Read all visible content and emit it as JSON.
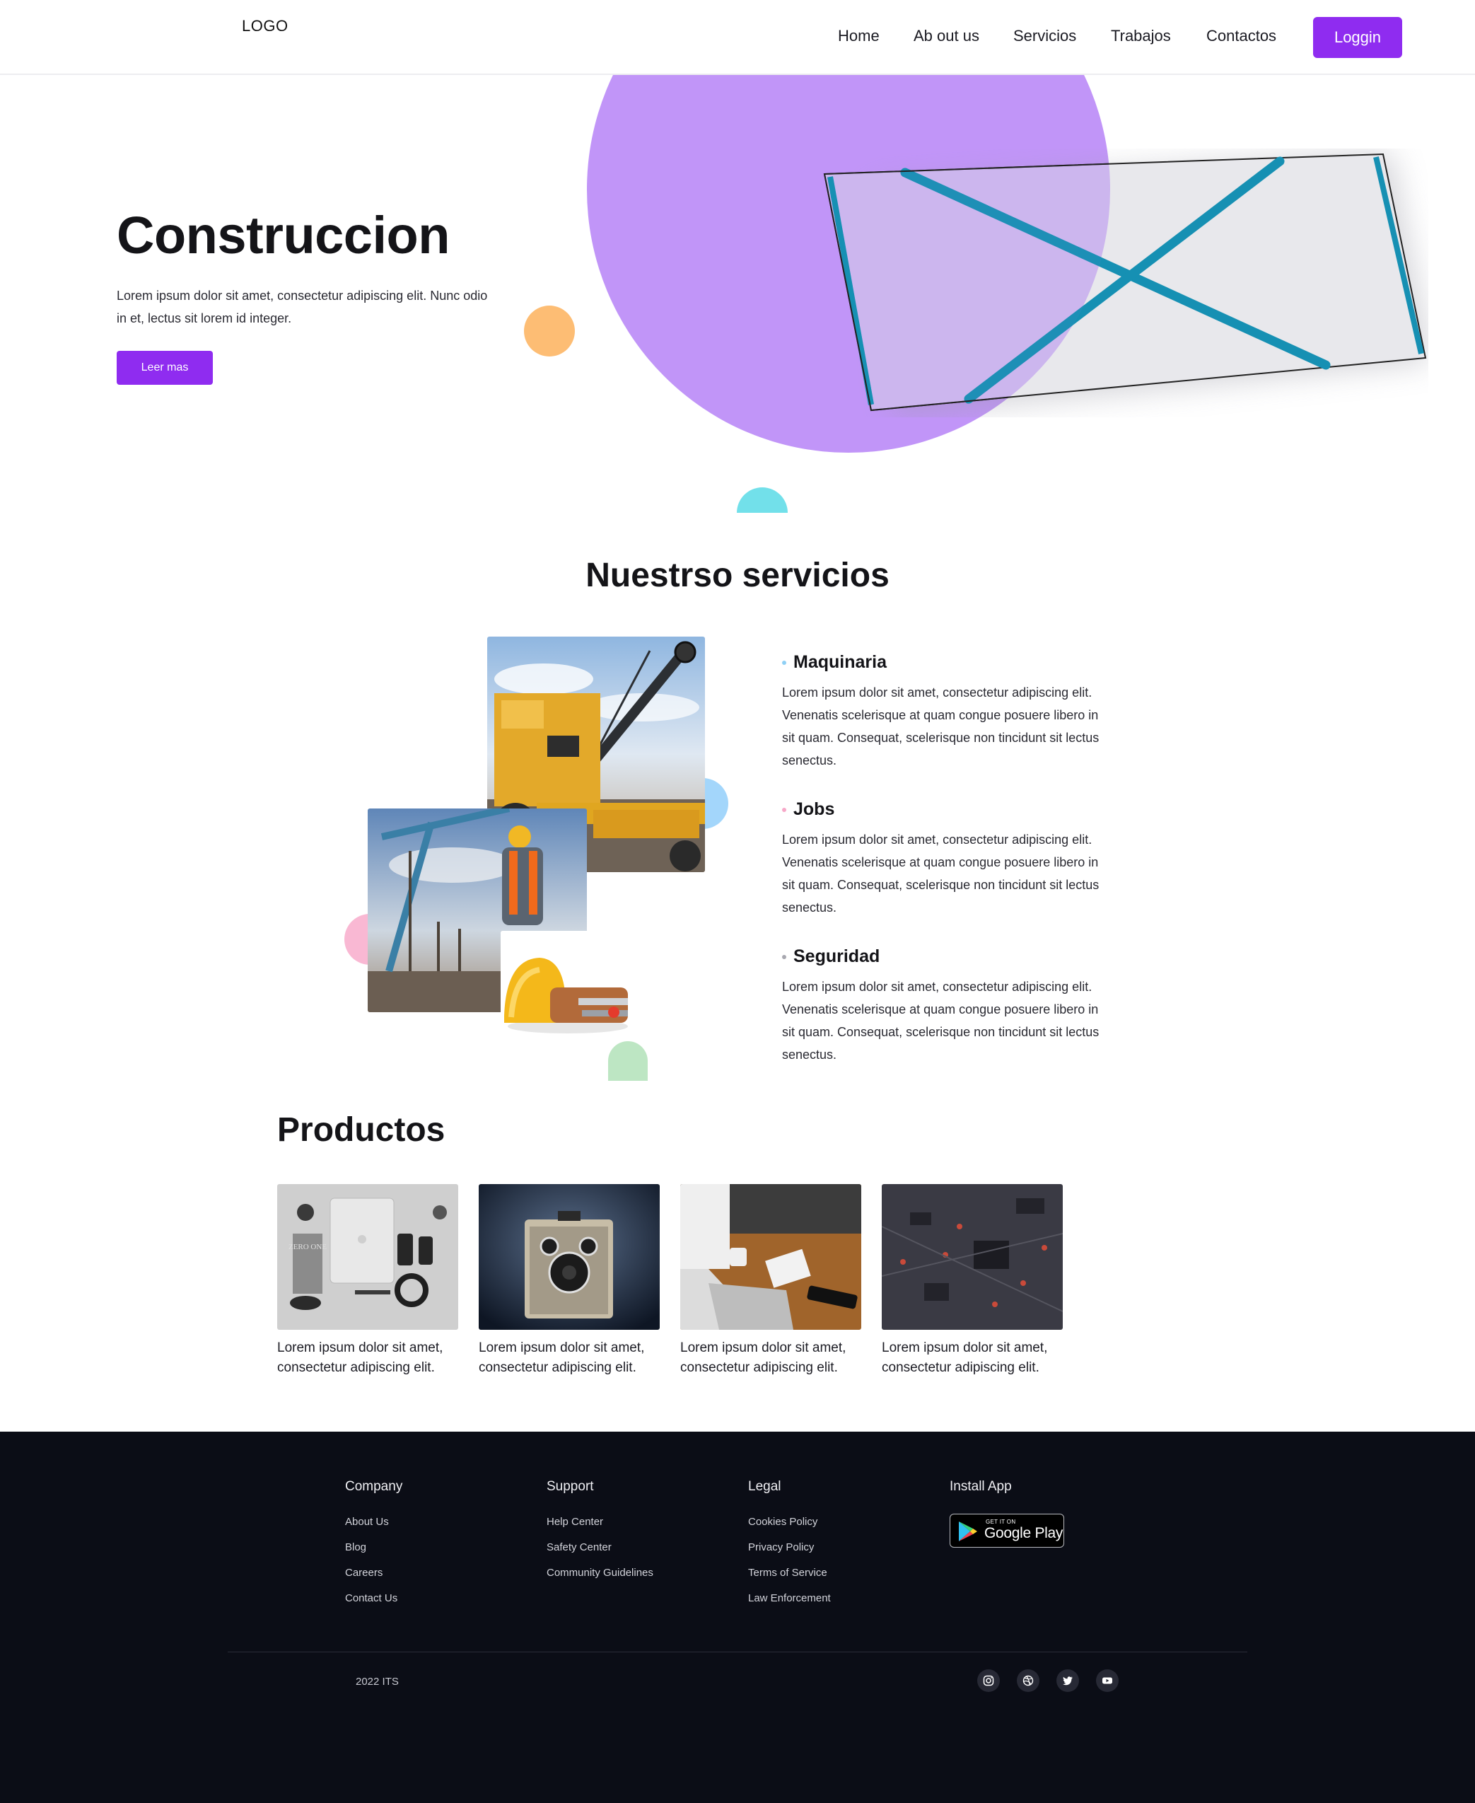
{
  "header": {
    "logo": "LOGO",
    "nav": [
      "Home",
      "Ab out us",
      "Servicios",
      "Trabajos",
      "Contactos"
    ],
    "login_label": "Loggin"
  },
  "hero": {
    "title": "Construccion",
    "text": "Lorem ipsum dolor sit amet, consectetur adipiscing elit. Nunc odio in et, lectus sit lorem id integer.",
    "button_label": "Leer mas",
    "image_icon": "broken-image-placeholder-icon"
  },
  "services": {
    "title": "Nuestrso servicios",
    "items": [
      {
        "title": "Maquinaria",
        "text": "Lorem ipsum dolor sit amet, consectetur adipiscing elit. Venenatis scelerisque at quam congue posuere libero in sit quam. Consequat, scelerisque non tincidunt sit lectus senectus.",
        "bullet_color": "#8fd0f5"
      },
      {
        "title": "Jobs",
        "text": "Lorem ipsum dolor sit amet, consectetur adipiscing elit. Venenatis scelerisque at quam congue posuere libero in sit quam. Consequat, scelerisque non tincidunt sit lectus senectus.",
        "bullet_color": "#f7a8c8"
      },
      {
        "title": "Seguridad",
        "text": "Lorem ipsum dolor sit amet, consectetur adipiscing elit. Venenatis scelerisque at quam congue posuere libero in sit quam. Consequat, scelerisque non tincidunt sit lectus senectus.",
        "bullet_color": "#a8a8b0"
      }
    ]
  },
  "products": {
    "title": "Productos",
    "items": [
      {
        "caption": "Lorem ipsum dolor sit amet, consectetur adipiscing elit.",
        "book_text": "ZERO ONE"
      },
      {
        "caption": "Lorem ipsum dolor sit amet, consectetur adipiscing elit."
      },
      {
        "caption": "Lorem ipsum dolor sit amet, consectetur adipiscing elit."
      },
      {
        "caption": "Lorem ipsum dolor sit amet, consectetur adipiscing elit."
      }
    ]
  },
  "footer": {
    "columns": [
      {
        "title": "Company",
        "links": [
          "About Us",
          "Blog",
          "Careers",
          "Contact Us"
        ]
      },
      {
        "title": "Support",
        "links": [
          "Help Center",
          "Safety Center",
          "Community Guidelines"
        ]
      },
      {
        "title": "Legal",
        "links": [
          "Cookies Policy",
          "Privacy Policy",
          "Terms of Service",
          "Law Enforcement"
        ]
      }
    ],
    "install_title": "Install App",
    "google_play_small": "GET IT ON",
    "google_play_big": "Google Play",
    "copyright": "2022 ITS",
    "social_icons": [
      "instagram-icon",
      "dribbble-icon",
      "twitter-icon",
      "youtube-icon"
    ]
  },
  "colors": {
    "accent": "#8f2cf0",
    "hero_circle": "#c195f8",
    "footer_bg": "#0b0d16"
  }
}
